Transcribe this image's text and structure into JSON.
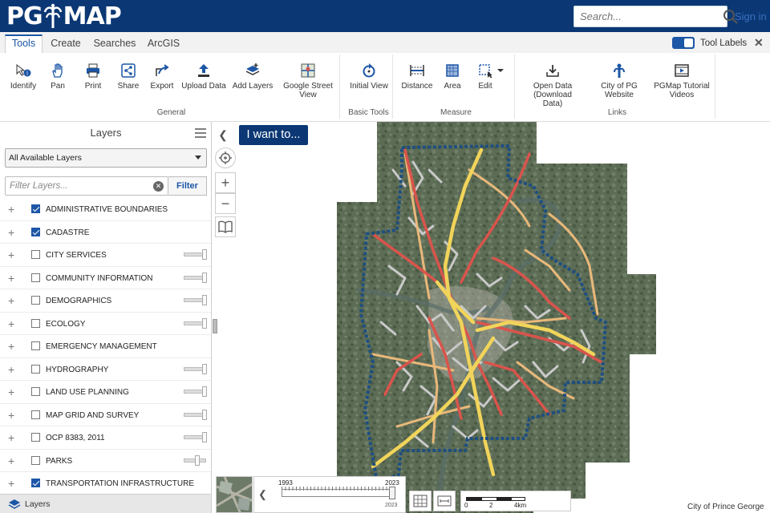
{
  "header": {
    "logo_left": "PG",
    "logo_right": "MAP",
    "search_placeholder": "Search...",
    "sign_in": "Sign in"
  },
  "tabs": [
    {
      "label": "Tools",
      "active": true
    },
    {
      "label": "Create",
      "active": false
    },
    {
      "label": "Searches",
      "active": false
    },
    {
      "label": "ArcGIS",
      "active": false
    }
  ],
  "tool_labels": {
    "label": "Tool Labels",
    "enabled": true
  },
  "ribbon": {
    "groups": [
      {
        "label": "General"
      },
      {
        "label": "Basic Tools"
      },
      {
        "label": "Measure"
      },
      {
        "label": "Links"
      }
    ],
    "tools": {
      "identify": "Identify",
      "pan": "Pan",
      "print": "Print",
      "share": "Share",
      "export": "Export",
      "upload": "Upload Data",
      "add_layers": "Add Layers",
      "street_view_1": "Google Street",
      "street_view_2": "View",
      "initial_view": "Initial View",
      "distance": "Distance",
      "area": "Area",
      "edit": "Edit",
      "open_data_1": "Open Data",
      "open_data_2": "(Download",
      "open_data_3": "Data)",
      "city_pg_1": "City of PG",
      "city_pg_2": "Website",
      "tutorial_1": "PGMap Tutorial",
      "tutorial_2": "Videos"
    }
  },
  "layers_panel": {
    "title": "Layers",
    "select_value": "All Available Layers",
    "filter_placeholder": "Filter Layers...",
    "filter_button": "Filter",
    "layers": [
      {
        "name": "ADMINISTRATIVE BOUNDARIES",
        "checked": true,
        "slider": false
      },
      {
        "name": "CADASTRE",
        "checked": true,
        "slider": false
      },
      {
        "name": "CITY SERVICES",
        "checked": false,
        "slider": true
      },
      {
        "name": "COMMUNITY INFORMATION",
        "checked": false,
        "slider": true
      },
      {
        "name": "DEMOGRAPHICS",
        "checked": false,
        "slider": true
      },
      {
        "name": "ECOLOGY",
        "checked": false,
        "slider": true
      },
      {
        "name": "EMERGENCY MANAGEMENT",
        "checked": false,
        "slider": false
      },
      {
        "name": "HYDROGRAPHY",
        "checked": false,
        "slider": true
      },
      {
        "name": "LAND USE PLANNING",
        "checked": false,
        "slider": true
      },
      {
        "name": "MAP GRID AND SURVEY",
        "checked": false,
        "slider": true
      },
      {
        "name": "OCP 8383, 2011",
        "checked": false,
        "slider": true
      },
      {
        "name": "PARKS",
        "checked": false,
        "slider": true
      },
      {
        "name": "TRANSPORTATION INFRASTRUCTURE",
        "checked": true,
        "slider": false
      }
    ],
    "footer_tab": "Layers"
  },
  "map": {
    "i_want_to": "I want to...",
    "timeline_start": "1993",
    "timeline_end": "2023",
    "timeline_current": "2023",
    "scale_labels": [
      "0",
      "2",
      "4km"
    ],
    "credit": "City of Prince George",
    "colors": {
      "boundary": "#1f4f80",
      "arterial": "#d9544c",
      "highway": "#f1d45a",
      "collector": "#e8b87a",
      "local": "#c9c9c9",
      "imagery": "#5f6f58"
    }
  }
}
